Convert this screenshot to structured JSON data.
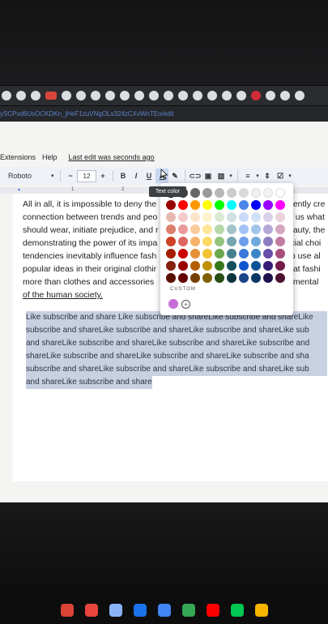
{
  "browser": {
    "url_text": "ySCPvd6UsOCKDKn_jHeF1zuVNgOLs324zCXvWnTEo/edit",
    "bookmarks": [
      "g",
      "g",
      "g",
      "yt",
      "g",
      "g",
      "g",
      "g",
      "g",
      "g",
      "g",
      "g",
      "g",
      "g",
      "g",
      "g",
      "g",
      "p",
      "g",
      "g",
      "g"
    ]
  },
  "docs": {
    "menu": {
      "extensions": "Extensions",
      "help": "Help",
      "last_edit": "Last edit was seconds ago"
    },
    "toolbar": {
      "font": "Roboto",
      "minus": "−",
      "font_size": "12",
      "plus": "+",
      "bold": "B",
      "italic": "I",
      "underline": "U",
      "text_color": "A"
    },
    "ruler": {
      "one": "1",
      "two": "2"
    },
    "paragraph_lines": [
      "All in all, it is impossible to deny the",
      "connection between trends and peo",
      "should wear, initiate prejudice, and r",
      "demonstrating the power of its impa",
      "tendencies inevitably influence fash",
      "popular ideas in their original clothir",
      "more than clothes and accessories",
      "of the human society."
    ],
    "right_column_lines": [
      "dently cre",
      "e us what",
      "eauty, the",
      "icial choi",
      "to use al",
      "hat fashi",
      "amental",
      ""
    ],
    "highlight_lines": [
      "Like subscribe and share Like subscribe and shareLike subscribe and shareLike",
      "subscribe and shareLike subscribe and shareLike subscribe and shareLike sub",
      "and shareLike subscribe and shareLike subscribe and shareLike subscribe and",
      "shareLike subscribe and shareLike subscribe and shareLike subscribe and sha",
      "subscribe and shareLike subscribe and shareLike subscribe and shareLike sub",
      "and shareLike subscribe and share"
    ],
    "tooltip": "Text color",
    "palette": {
      "rows": [
        [
          "#000000",
          "#434343",
          "#666666",
          "#999999",
          "#b7b7b7",
          "#cccccc",
          "#d9d9d9",
          "#efefef",
          "#f3f3f3",
          "#ffffff"
        ],
        [
          "#980000",
          "#ff0000",
          "#ff9900",
          "#ffff00",
          "#00ff00",
          "#00ffff",
          "#4a86e8",
          "#0000ff",
          "#9900ff",
          "#ff00ff"
        ],
        [
          "#e6b8af",
          "#f4cccc",
          "#fce5cd",
          "#fff2cc",
          "#d9ead3",
          "#d0e0e3",
          "#c9daf8",
          "#cfe2f3",
          "#d9d2e9",
          "#ead1dc"
        ],
        [
          "#dd7e6b",
          "#ea9999",
          "#f9cb9c",
          "#ffe599",
          "#b6d7a8",
          "#a2c4c9",
          "#a4c2f4",
          "#9fc5e8",
          "#b4a7d6",
          "#d5a6bd"
        ],
        [
          "#cc4125",
          "#e06666",
          "#f6b26b",
          "#ffd966",
          "#93c47d",
          "#76a5af",
          "#6d9eeb",
          "#6fa8dc",
          "#8e7cc3",
          "#c27ba0"
        ],
        [
          "#a61c00",
          "#cc0000",
          "#e69138",
          "#f1c232",
          "#6aa84f",
          "#45818e",
          "#3c78d8",
          "#3d85c6",
          "#674ea7",
          "#a64d79"
        ],
        [
          "#85200c",
          "#990000",
          "#b45f06",
          "#bf9000",
          "#38761d",
          "#134f5c",
          "#1155cc",
          "#0b5394",
          "#351c75",
          "#741b47"
        ],
        [
          "#5b0f00",
          "#660000",
          "#783f04",
          "#7f6000",
          "#274e13",
          "#0c343d",
          "#1c4587",
          "#073763",
          "#20124d",
          "#4c1130"
        ]
      ],
      "custom_label": "CUSTOM",
      "custom_color": "#c86dd7",
      "add_symbol": "+"
    }
  },
  "shelf": {
    "apps": [
      "#db4437",
      "#e8453c",
      "#8ab4f8",
      "#1a73e8",
      "#4285f4",
      "#34a853",
      "#ff0000",
      "#00c853",
      "#f4b400"
    ]
  }
}
